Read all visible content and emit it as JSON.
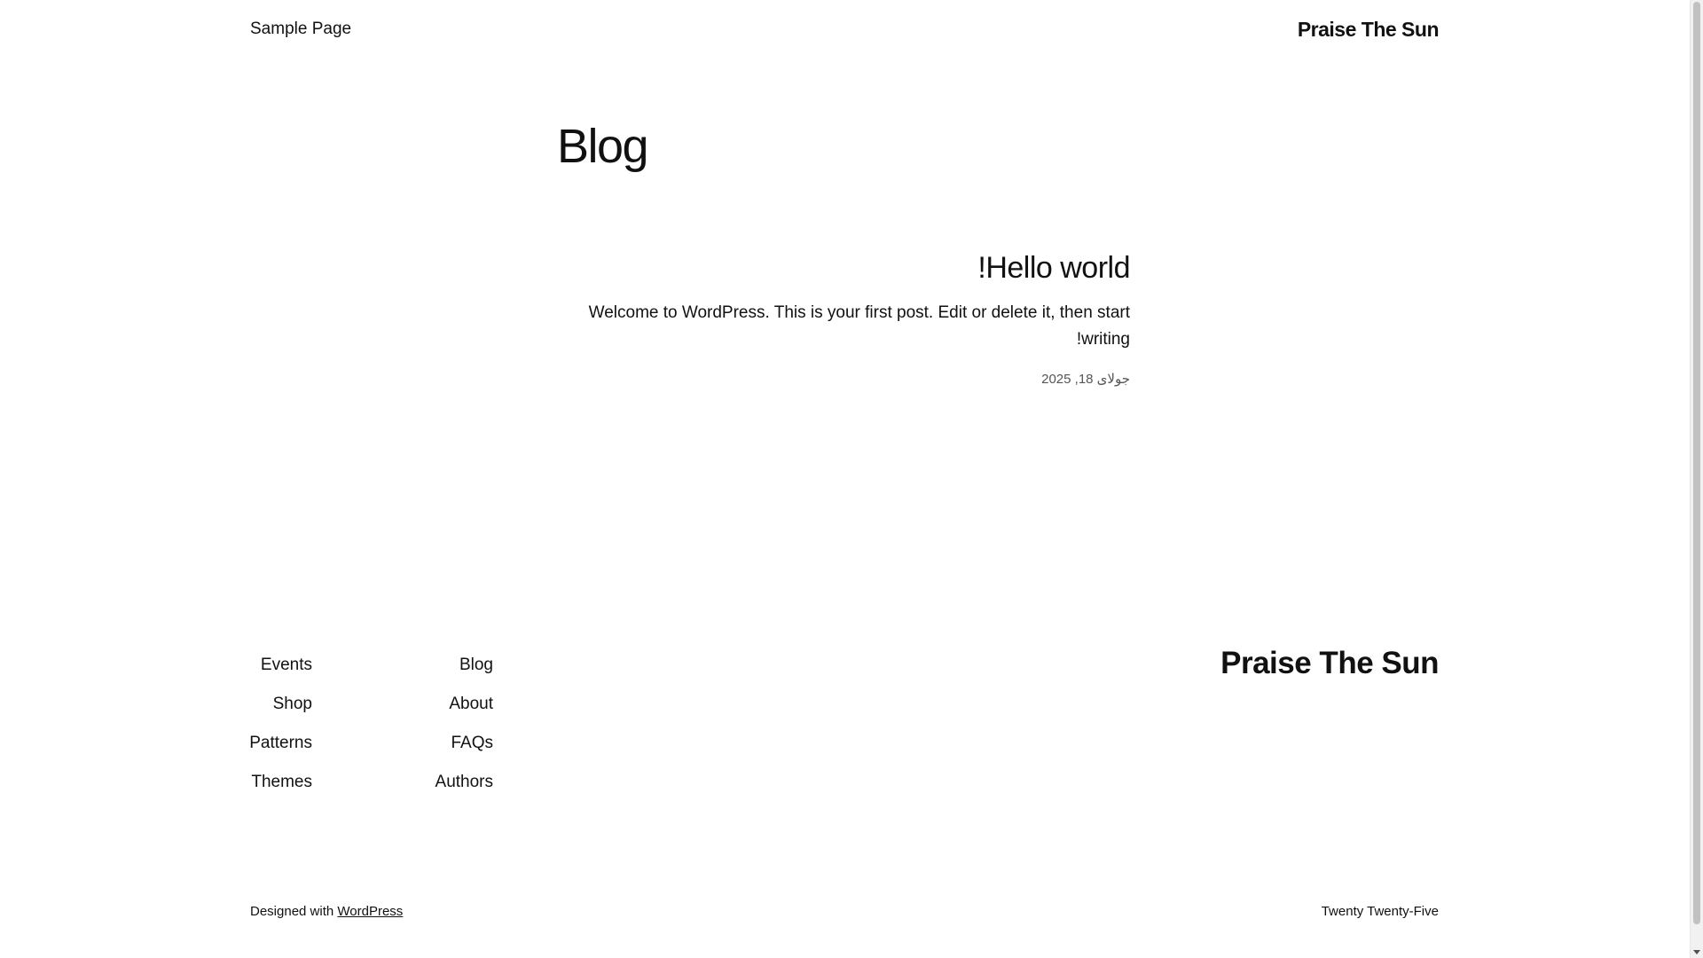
{
  "header": {
    "nav_link": "Sample Page",
    "site_title": "Praise The Sun"
  },
  "main": {
    "page_title": "Blog",
    "post": {
      "title": "Hello world!",
      "excerpt": "Welcome to WordPress. This is your first post. Edit or delete it, then start writing!",
      "date": "جولای 18, 2025"
    }
  },
  "footer": {
    "site_title": "Praise The Sun",
    "nav_left": [
      "Events",
      "Shop",
      "Patterns",
      "Themes"
    ],
    "nav_right": [
      "Blog",
      "About",
      "FAQs",
      "Authors"
    ],
    "credit_prefix": "Designed with",
    "credit_link": "WordPress",
    "theme_name": "Twenty Twenty-Five"
  }
}
